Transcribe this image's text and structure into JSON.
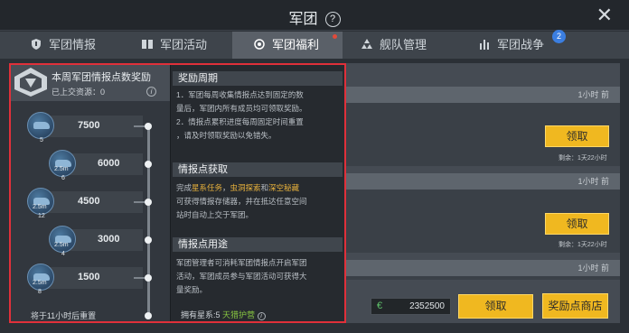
{
  "window": {
    "title": "军团",
    "help_glyph": "?",
    "close_glyph": "✕"
  },
  "tabs": [
    {
      "label": "军团情报",
      "icon": "shield-icon"
    },
    {
      "label": "军团活动",
      "icon": "book-icon"
    },
    {
      "label": "军团福利",
      "icon": "gift-icon",
      "active": true
    },
    {
      "label": "舰队管理",
      "icon": "fleet-icon"
    },
    {
      "label": "军团战争",
      "icon": "tower-icon",
      "badge": "2"
    }
  ],
  "reward_panel": {
    "title": "本周军团情报点数奖励",
    "collected": "已上交资源：0",
    "info_glyph": "i",
    "tiers": [
      {
        "points": "7500",
        "count": "5"
      },
      {
        "points": "6000",
        "count": "6"
      },
      {
        "points": "4500",
        "count": "12"
      },
      {
        "points": "3000",
        "count": "4"
      },
      {
        "points": "1500",
        "count": "8"
      }
    ],
    "ship_label": "2.5m",
    "reset_text": "将于11小时后重置"
  },
  "tooltip": {
    "sections": [
      {
        "heading": "奖励周期",
        "lines": [
          "1．军团每周收集情报点达到固定的数",
          "量后，军团内所有成员均可领取奖励。",
          "2．情报点累积进度每周固定时间重置",
          "，请及时领取奖励以免错失。"
        ]
      },
      {
        "heading": "情报点获取",
        "line1_prefix": "完成",
        "line1_hl1": "星系任务",
        "line1_sep1": "，",
        "line1_hl2": "虫洞探索",
        "line1_sep2": "和",
        "line1_hl3": "深空秘藏",
        "lines_rest": [
          "可获得情报存储器，并在抵达任意空间",
          "站时自动上交于军团。"
        ]
      },
      {
        "heading": "情报点用途",
        "lines": [
          "军团管理者可消耗军团情报点开启军团",
          "活动，军团成员参与军团活动可获得大",
          "量奖励。"
        ]
      }
    ]
  },
  "right_cards": [
    {
      "time": "1小时 前",
      "button": "领取",
      "remaining": "剩余：1天22小时"
    },
    {
      "time": "1小时 前",
      "button": "领取",
      "remaining": "剩余：1天22小时"
    },
    {
      "time": "1小时 前"
    }
  ],
  "bottom": {
    "owned_prefix": "拥有星系:",
    "owned_value": "5",
    "owned_suffix": "天猎护营",
    "currency_value": "2352500",
    "claim_button": "领取",
    "shop_button": "奖励点商店"
  },
  "colors": {
    "accent": "#f0b820",
    "highlight": "#e0303a",
    "link": "#e9b23c",
    "green": "#86c440"
  }
}
